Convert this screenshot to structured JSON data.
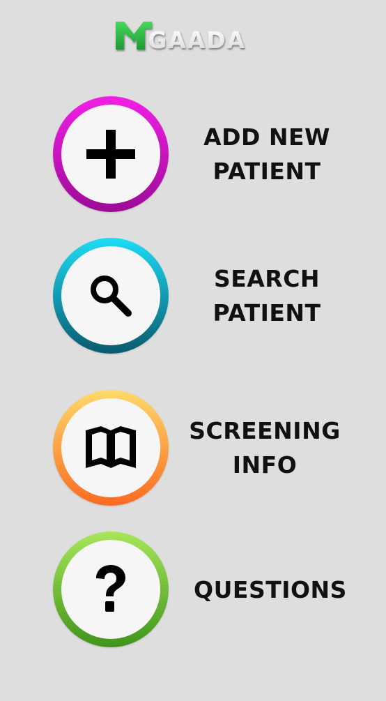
{
  "app": {
    "logo_text": "GAADA",
    "logo_mark": "M",
    "accent_green": "#2fb34a"
  },
  "menu": [
    {
      "id": "add-new-patient",
      "label": "ADD NEW\nPATIENT",
      "icon": "plus-icon",
      "ring_colors": [
        "#f21fe5",
        "#9c0b97"
      ]
    },
    {
      "id": "search-patient",
      "label": "SEARCH\nPATIENT",
      "icon": "search-icon",
      "ring_colors": [
        "#1ddcf5",
        "#0a5a6e"
      ]
    },
    {
      "id": "screening-info",
      "label": "SCREENING\nINFO",
      "icon": "book-icon",
      "ring_colors": [
        "#ffda6a",
        "#fb6a21"
      ]
    },
    {
      "id": "questions",
      "label": "QUESTIONS",
      "icon": "question-icon",
      "ring_colors": [
        "#a8e65a",
        "#3f951b"
      ]
    }
  ]
}
